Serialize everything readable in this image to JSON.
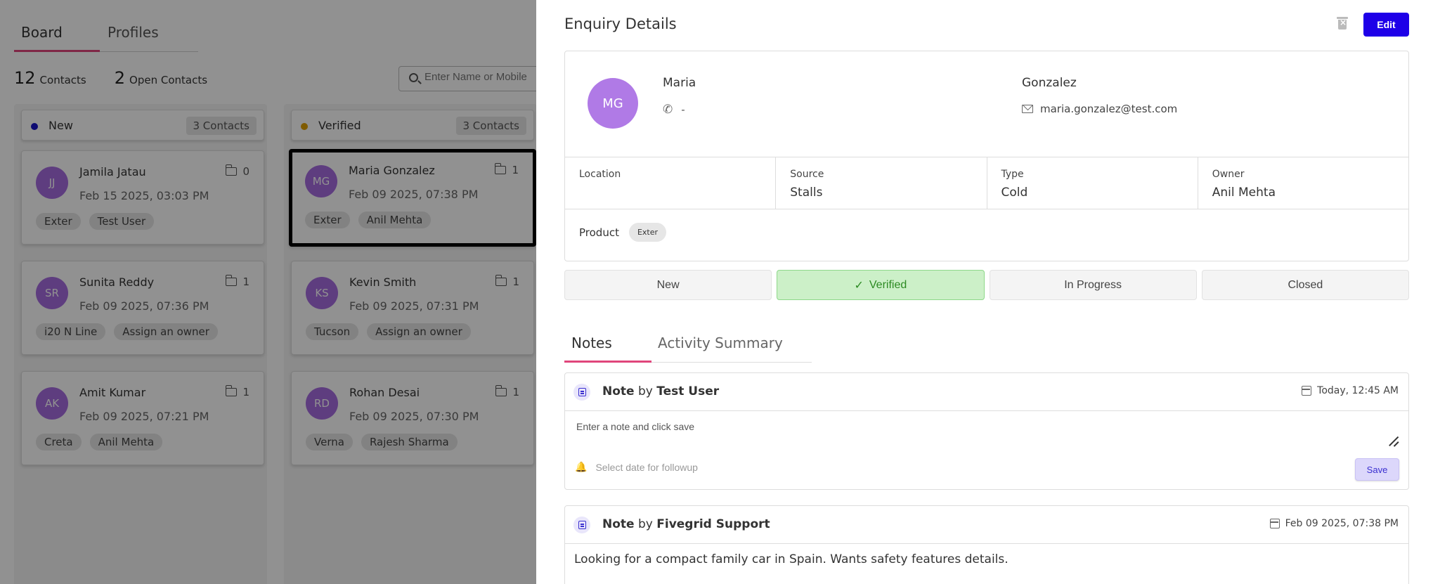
{
  "board": {
    "tabs": [
      {
        "label": "Board"
      },
      {
        "label": "Profiles"
      }
    ],
    "counts": [
      {
        "number": "12",
        "label": "Contacts"
      },
      {
        "number": "2",
        "label": "Open Contacts"
      }
    ],
    "search": {
      "placeholder": "Enter Name or Mobile"
    },
    "columns": [
      {
        "title": "New",
        "badge": "3 Contacts",
        "dot_color": "#1a14c8",
        "cards": [
          {
            "initials": "JJ",
            "name": "Jamila Jatau",
            "date": "Feb 15 2025, 03:03 PM",
            "count": "0",
            "chips": [
              "Exter",
              "Test User"
            ]
          },
          {
            "initials": "SR",
            "name": "Sunita Reddy",
            "date": "Feb 09 2025, 07:36 PM",
            "count": "1",
            "chips": [
              "i20 N Line",
              "Assign an owner"
            ]
          },
          {
            "initials": "AK",
            "name": "Amit Kumar",
            "date": "Feb 09 2025, 07:21 PM",
            "count": "1",
            "chips": [
              "Creta",
              "Anil Mehta"
            ]
          }
        ]
      },
      {
        "title": "Verified",
        "badge": "3 Contacts",
        "dot_color": "#e0a000",
        "cards": [
          {
            "initials": "MG",
            "name": "Maria Gonzalez",
            "date": "Feb 09 2025, 07:38 PM",
            "count": "1",
            "chips": [
              "Exter",
              "Anil Mehta"
            ]
          },
          {
            "initials": "KS",
            "name": "Kevin Smith",
            "date": "Feb 09 2025, 07:31 PM",
            "count": "1",
            "chips": [
              "Tucson",
              "Assign an owner"
            ]
          },
          {
            "initials": "RD",
            "name": "Rohan Desai",
            "date": "Feb 09 2025, 07:30 PM",
            "count": "1",
            "chips": [
              "Verna",
              "Rajesh Sharma"
            ]
          }
        ]
      }
    ]
  },
  "drawer": {
    "title": "Enquiry Details",
    "edit_label": "Edit",
    "profile": {
      "initials": "MG",
      "first_name": "Maria",
      "last_name": "Gonzalez",
      "phone": "-",
      "email": "maria.gonzalez@test.com"
    },
    "info": [
      {
        "label": "Location",
        "value": ""
      },
      {
        "label": "Source",
        "value": "Stalls"
      },
      {
        "label": "Type",
        "value": "Cold"
      },
      {
        "label": "Owner",
        "value": "Anil Mehta"
      }
    ],
    "product": {
      "label": "Product",
      "chip": "Exter"
    },
    "statuses": [
      {
        "label": "New",
        "active": false
      },
      {
        "label": "Verified",
        "active": true
      },
      {
        "label": "In Progress",
        "active": false
      },
      {
        "label": "Closed",
        "active": false
      }
    ],
    "tabs": [
      {
        "label": "Notes"
      },
      {
        "label": "Activity Summary"
      }
    ],
    "new_note": {
      "prefix": "Note",
      "by": "by",
      "author": "Test User",
      "date": "Today, 12:45 AM",
      "placeholder": "Enter a note and click save",
      "followup_placeholder": "Select date for followup",
      "save_label": "Save"
    },
    "existing_note": {
      "prefix": "Note",
      "by": "by",
      "author": "Fivegrid Support",
      "date": "Feb 09 2025, 07:38 PM",
      "body": "Looking for a compact family car in Spain. Wants safety features details."
    }
  }
}
